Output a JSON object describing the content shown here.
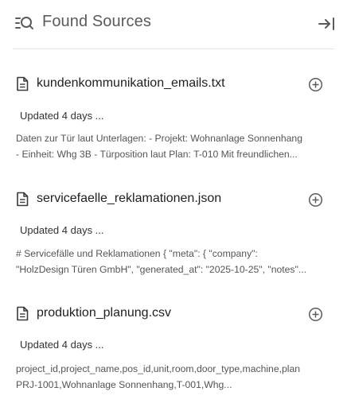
{
  "header": {
    "title": "Found Sources",
    "icon": "search-list-icon",
    "collapse_icon": "collapse-panel-icon"
  },
  "sources": [
    {
      "file_name": "kundenkommunikation_emails.txt",
      "updated": "Updated 4 days ...",
      "preview_lines": [
        "Daten zur Tür laut Unterlagen: - Projekt: Wohnanlage Sonnenhang",
        "- Einheit: Whg 3B - Türposition laut Plan: T-010 Mit freundlichen..."
      ]
    },
    {
      "file_name": "servicefaelle_reklamationen.json",
      "updated": "Updated 4 days ...",
      "preview_lines": [
        "# Servicefälle und Reklamationen { \"meta\": { \"company\":",
        "\"HolzDesign Türen GmbH\", \"generated_at\": \"2025-10-25\", \"notes\"..."
      ]
    },
    {
      "file_name": "produktion_planung.csv",
      "updated": "Updated 4 days ...",
      "preview_lines": [
        "project_id,project_name,pos_id,unit,room,door_type,machine,plan",
        "PRJ-1001,Wohnanlage Sonnenhang,T-001,Whg..."
      ]
    }
  ],
  "colors": {
    "title": "#5b5b5b",
    "file_name": "#1f1f1f",
    "preview": "#555555",
    "divider": "#e6e6e6"
  }
}
